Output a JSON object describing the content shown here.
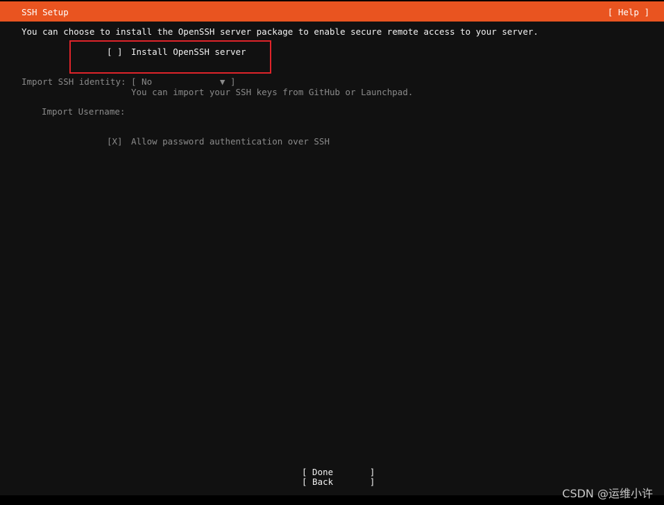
{
  "header": {
    "title": "SSH Setup",
    "help_label": "[ Help ]",
    "accent_color": "#e95420"
  },
  "intro_text": "You can choose to install the OpenSSH server package to enable secure remote access to your server.",
  "install_openssh": {
    "checkbox": "[ ]",
    "label": "Install OpenSSH server"
  },
  "import_identity": {
    "label": "Import SSH identity:",
    "select_value": "[ No             ▼ ]",
    "help": "You can import your SSH keys from GitHub or Launchpad."
  },
  "import_username": {
    "label": "Import Username:"
  },
  "allow_password": {
    "checkbox": "[X]",
    "label": "Allow password authentication over SSH"
  },
  "buttons": {
    "done": "[ Done       ]",
    "back": "[ Back       ]"
  },
  "watermark": "CSDN @运维小许"
}
